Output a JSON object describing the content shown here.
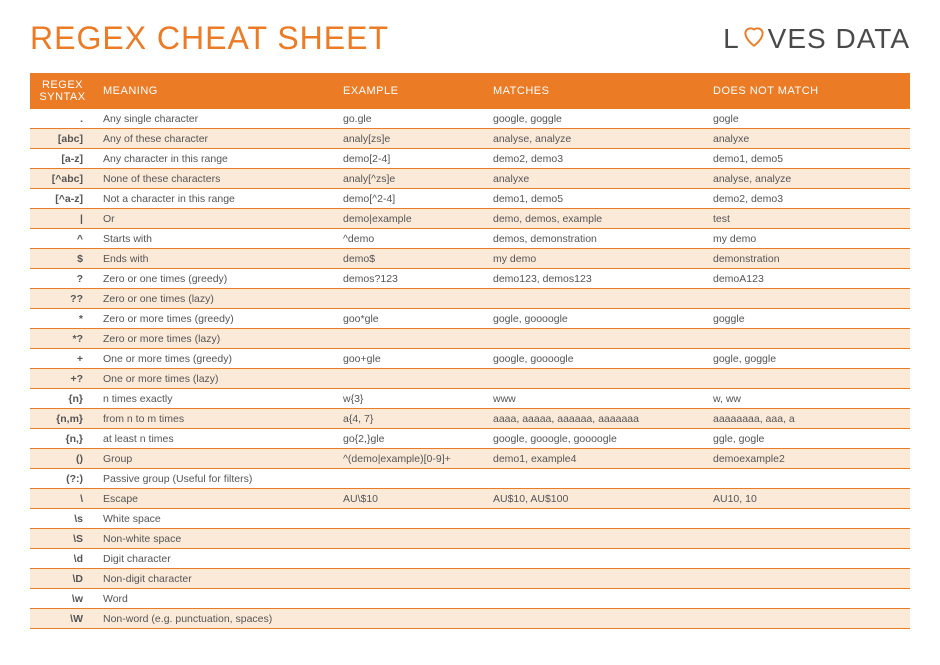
{
  "header": {
    "title": "REGEX CHEAT SHEET",
    "logo_prefix": "L",
    "logo_suffix": "VES DATA"
  },
  "table": {
    "headers": {
      "syntax_line1": "REGEX",
      "syntax_line2": "SYNTAX",
      "meaning": "MEANING",
      "example": "EXAMPLE",
      "matches": "MATCHES",
      "notmatch": "DOES NOT MATCH"
    },
    "rows": [
      {
        "syntax": ".",
        "meaning": "Any single character",
        "example": "go.gle",
        "matches": "google, goggle",
        "notmatch": "gogle"
      },
      {
        "syntax": "[abc]",
        "meaning": "Any of these character",
        "example": "analy[zs]e",
        "matches": "analyse, analyze",
        "notmatch": "analyxe"
      },
      {
        "syntax": "[a-z]",
        "meaning": "Any character in this range",
        "example": "demo[2-4]",
        "matches": "demo2, demo3",
        "notmatch": "demo1, demo5"
      },
      {
        "syntax": "[^abc]",
        "meaning": "None of these characters",
        "example": "analy[^zs]e",
        "matches": "analyxe",
        "notmatch": "analyse, analyze"
      },
      {
        "syntax": "[^a-z]",
        "meaning": "Not a character in this range",
        "example": "demo[^2-4]",
        "matches": "demo1, demo5",
        "notmatch": "demo2, demo3"
      },
      {
        "syntax": "|",
        "meaning": "Or",
        "example": "demo|example",
        "matches": "demo, demos, example",
        "notmatch": "test"
      },
      {
        "syntax": "^",
        "meaning": "Starts with",
        "example": "^demo",
        "matches": "demos, demonstration",
        "notmatch": "my demo"
      },
      {
        "syntax": "$",
        "meaning": "Ends with",
        "example": "demo$",
        "matches": "my demo",
        "notmatch": "demonstration"
      },
      {
        "syntax": "?",
        "meaning": "Zero or one times (greedy)",
        "example": "demos?123",
        "matches": "demo123, demos123",
        "notmatch": "demoA123"
      },
      {
        "syntax": "??",
        "meaning": "Zero or one times (lazy)",
        "example": "",
        "matches": "",
        "notmatch": ""
      },
      {
        "syntax": "*",
        "meaning": "Zero or more times (greedy)",
        "example": "goo*gle",
        "matches": "gogle, goooogle",
        "notmatch": "goggle"
      },
      {
        "syntax": "*?",
        "meaning": "Zero or more times (lazy)",
        "example": "",
        "matches": "",
        "notmatch": ""
      },
      {
        "syntax": "+",
        "meaning": "One or more times (greedy)",
        "example": "goo+gle",
        "matches": "google, goooogle",
        "notmatch": "gogle, goggle"
      },
      {
        "syntax": "+?",
        "meaning": "One or more times (lazy)",
        "example": "",
        "matches": "",
        "notmatch": ""
      },
      {
        "syntax": "{n}",
        "meaning": "n times exactly",
        "example": "w{3}",
        "matches": "www",
        "notmatch": "w, ww"
      },
      {
        "syntax": "{n,m}",
        "meaning": "from n to m times",
        "example": "a{4, 7}",
        "matches": "aaaa, aaaaa, aaaaaa, aaaaaaa",
        "notmatch": "aaaaaaaa, aaa, a"
      },
      {
        "syntax": "{n,}",
        "meaning": "at least n times",
        "example": "go{2,}gle",
        "matches": "google, gooogle, goooogle",
        "notmatch": "ggle, gogle"
      },
      {
        "syntax": "()",
        "meaning": "Group",
        "example": "^(demo|example)[0-9]+",
        "matches": "demo1, example4",
        "notmatch": "demoexample2"
      },
      {
        "syntax": "(?:)",
        "meaning": "Passive group (Useful for filters)",
        "example": "",
        "matches": "",
        "notmatch": ""
      },
      {
        "syntax": "\\",
        "meaning": "Escape",
        "example": "AU\\$10",
        "matches": "AU$10, AU$100",
        "notmatch": "AU10, 10"
      },
      {
        "syntax": "\\s",
        "meaning": "White space",
        "example": "",
        "matches": "",
        "notmatch": ""
      },
      {
        "syntax": "\\S",
        "meaning": "Non-white space",
        "example": "",
        "matches": "",
        "notmatch": ""
      },
      {
        "syntax": "\\d",
        "meaning": "Digit character",
        "example": "",
        "matches": "",
        "notmatch": ""
      },
      {
        "syntax": "\\D",
        "meaning": "Non-digit character",
        "example": "",
        "matches": "",
        "notmatch": ""
      },
      {
        "syntax": "\\w",
        "meaning": "Word",
        "example": "",
        "matches": "",
        "notmatch": ""
      },
      {
        "syntax": "\\W",
        "meaning": "Non-word (e.g. punctuation, spaces)",
        "example": "",
        "matches": "",
        "notmatch": ""
      }
    ]
  }
}
